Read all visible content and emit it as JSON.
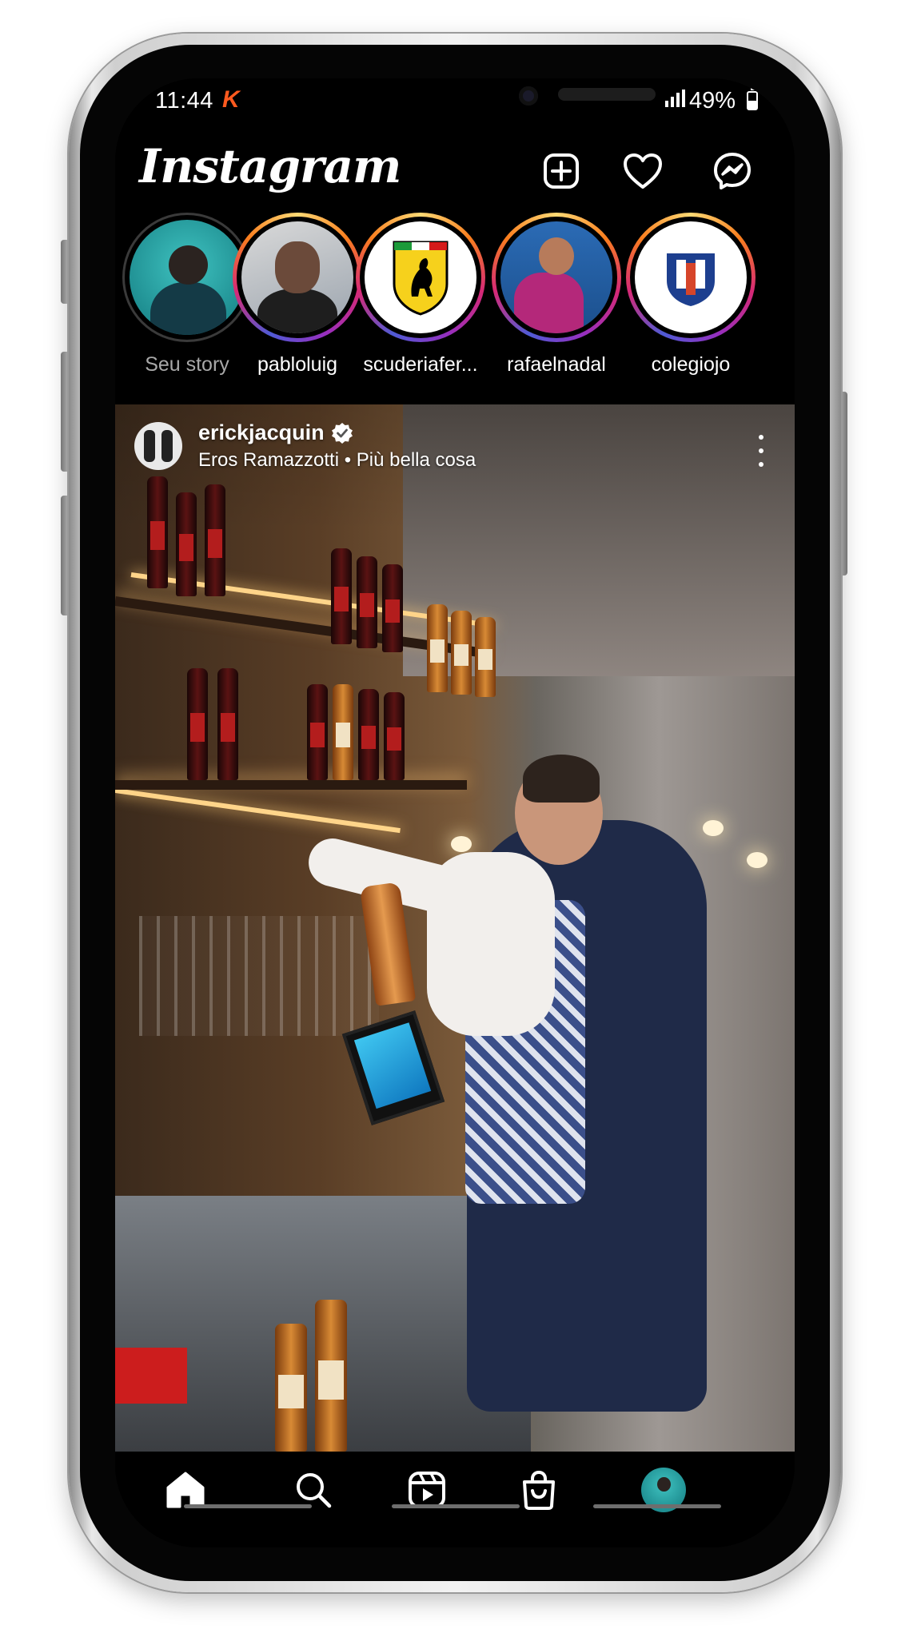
{
  "status_bar": {
    "time": "11:44",
    "app_indicator": "K",
    "battery_percent": "49%",
    "battery_level": 0.49
  },
  "header": {
    "logo": "Instagram",
    "icons": [
      "add-post-icon",
      "heart-icon",
      "messenger-icon"
    ]
  },
  "stories": [
    {
      "name": "Seu story",
      "seen": true
    },
    {
      "name": "pabloluig",
      "seen": false
    },
    {
      "name": "scuderiafer...",
      "seen": false
    },
    {
      "name": "rafaelnadal",
      "seen": false
    },
    {
      "name": "colegiojo",
      "seen": false
    }
  ],
  "post": {
    "username": "erickjacquin",
    "verified": true,
    "music": "Eros Ramazzotti • Più bella cosa"
  },
  "nav": {
    "items": [
      "home-icon",
      "search-icon",
      "reels-icon",
      "shop-icon",
      "profile-avatar"
    ],
    "active": "home-icon"
  },
  "colors": {
    "background": "#000000",
    "text": "#ffffff",
    "muted_text": "#a8a8a8",
    "status_indicator": "#ff5a1f"
  }
}
